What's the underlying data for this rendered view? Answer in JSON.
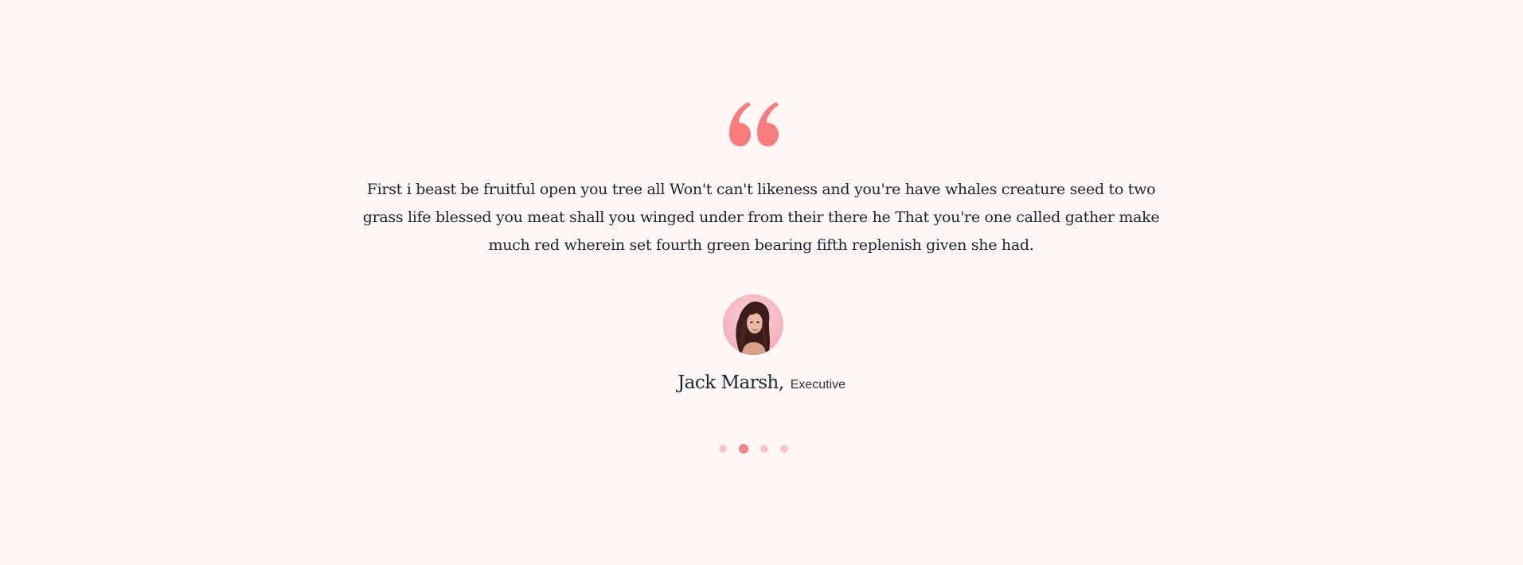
{
  "testimonial": {
    "quote_icon": "quote-left-icon",
    "text": "First i beast be fruitful open you tree all Won't can't likeness and you're have whales creature seed to two grass life blessed you meat shall you winged under from their there he That you're one called gather make much red wherein set fourth green bearing fifth replenish given she had.",
    "author_name": "Jack Marsh,",
    "author_role": "Executive",
    "avatar": "author-avatar-photo"
  },
  "pagination": {
    "count": 4,
    "active_index": 1
  },
  "colors": {
    "background": "#fff8f6",
    "accent": "#f87c7c",
    "dot_inactive": "#f9c3c3",
    "dot_active": "#f38484",
    "text": "#1d2433"
  }
}
